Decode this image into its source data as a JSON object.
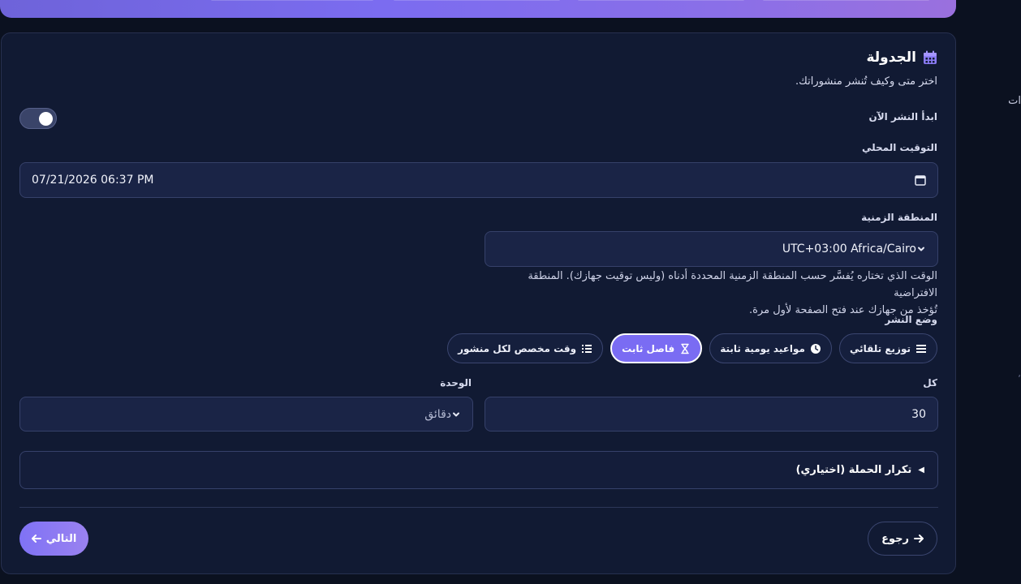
{
  "section": {
    "title": "الجدولة",
    "subtitle": "اختر متى وكيف تُنشر منشوراتك.",
    "accent_color": "#7a6cf3"
  },
  "start_now": {
    "label": "ابدأ النشر الآن",
    "enabled": true
  },
  "local_time": {
    "label": "التوقيت المحلي",
    "value": "07/21/2026 06:37 PM"
  },
  "timezone": {
    "label": "المنطقة الزمنية",
    "value": "UTC+03:00 Africa/Cairo",
    "help_line1": "الوقت الذي تختاره يُفسَّر حسب المنطقة الزمنية المحددة أدناه (وليس توقيت جهازك). المنطقة الافتراضية",
    "help_line2": "تُؤخذ من جهازك عند فتح الصفحة لأول مرة."
  },
  "publish_mode": {
    "label": "وضع النشر",
    "options": [
      {
        "label": "توزيع تلقائي",
        "icon": "bars-icon",
        "active": false
      },
      {
        "label": "مواعيد يومية ثابتة",
        "icon": "clock-icon",
        "active": false
      },
      {
        "label": "فاصل ثابت",
        "icon": "hourglass-icon",
        "active": true
      },
      {
        "label": "وقت مخصص لكل منشور",
        "icon": "list-icon",
        "active": false
      }
    ]
  },
  "interval": {
    "every_label": "كل",
    "every_value": "30",
    "unit_label": "الوحدة",
    "unit_value": "دقائق"
  },
  "repeat": {
    "label": "تكرار الحملة (اختياري)"
  },
  "footer": {
    "back_label": "رجوع",
    "next_label": "التالي"
  }
}
